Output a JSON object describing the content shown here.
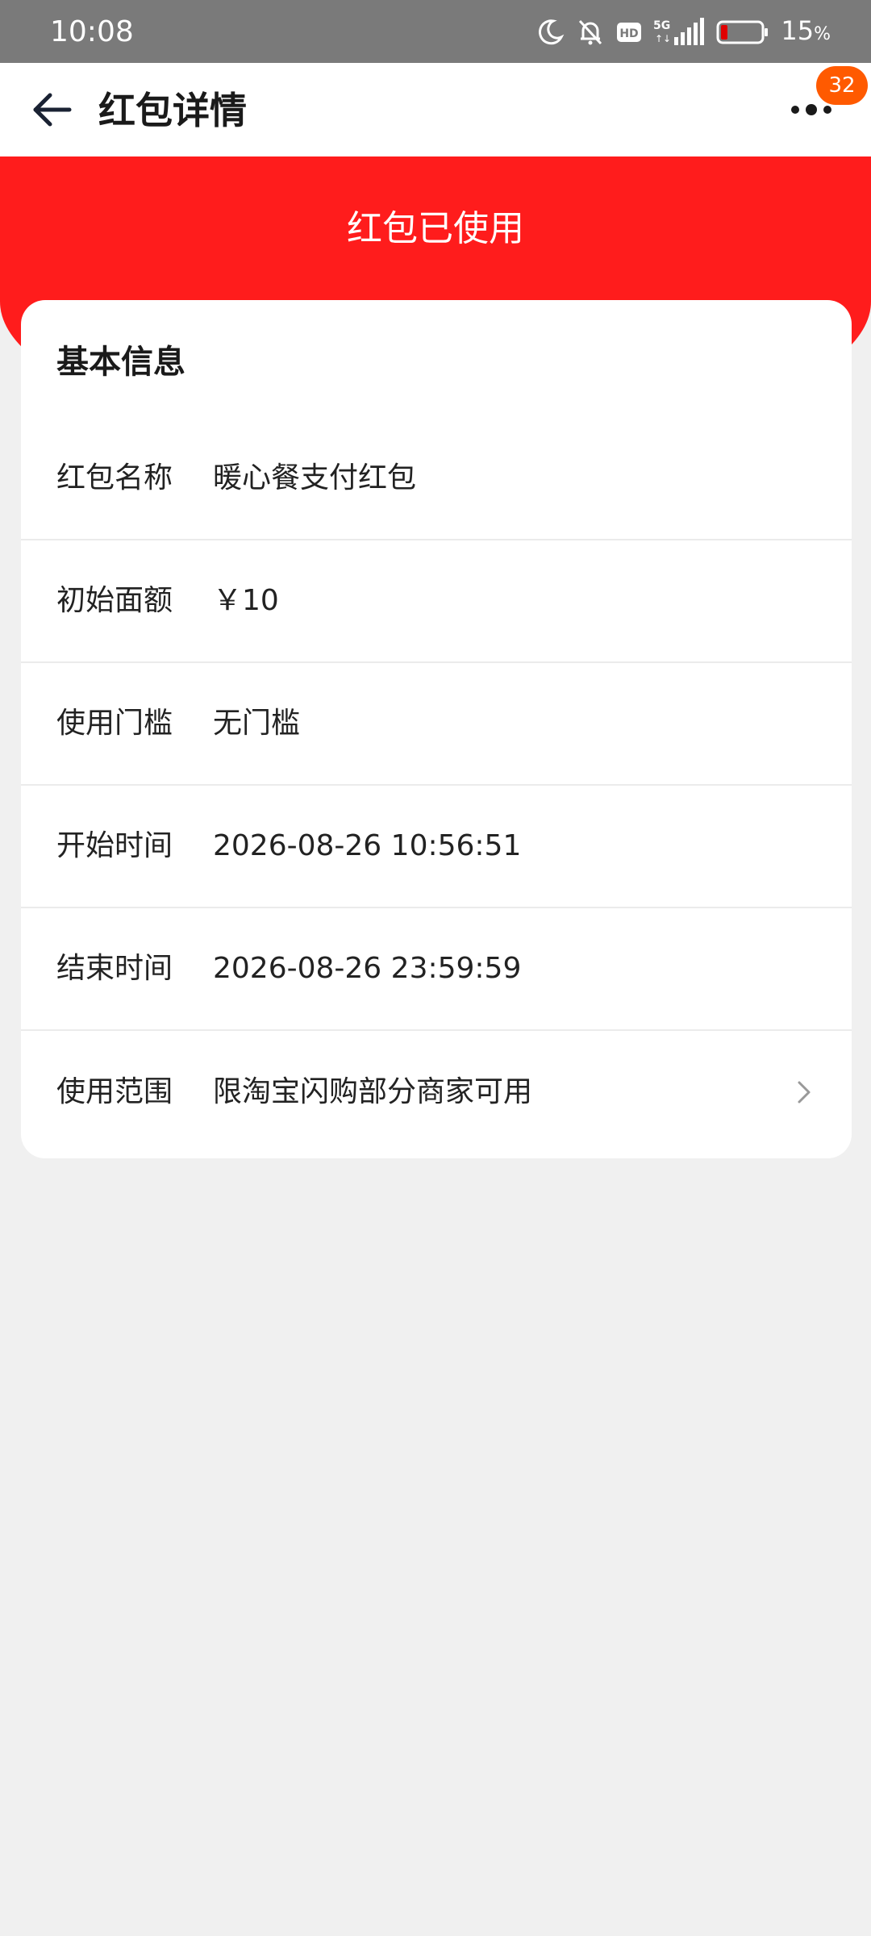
{
  "status_bar": {
    "time": "10:08",
    "battery_percent": "15",
    "battery_unit": "%",
    "network": "5G",
    "icons": [
      "moon-icon",
      "bell-off-icon",
      "hd-icon",
      "signal-icon",
      "battery-icon"
    ]
  },
  "app_bar": {
    "title": "红包详情",
    "badge_count": "32",
    "icons": [
      "back-arrow-icon",
      "more-dots-icon"
    ]
  },
  "header": {
    "status_text": "红包已使用"
  },
  "card": {
    "title": "基本信息",
    "rows": [
      {
        "label": "红包名称",
        "value": "暖心餐支付红包"
      },
      {
        "label": "初始面额",
        "value": "￥10"
      },
      {
        "label": "使用门槛",
        "value": "无门槛"
      },
      {
        "label": "开始时间",
        "value": "2026-08-26 10:56:51"
      },
      {
        "label": "结束时间",
        "value": "2026-08-26 23:59:59"
      },
      {
        "label": "使用范围",
        "value": "限淘宝闪购部分商家可用"
      }
    ]
  },
  "colors": {
    "accent_red": "#ff1c1c",
    "badge_orange": "#ff5a00",
    "status_bar_gray": "#7a7a7a",
    "page_background": "#f0f0f0"
  }
}
